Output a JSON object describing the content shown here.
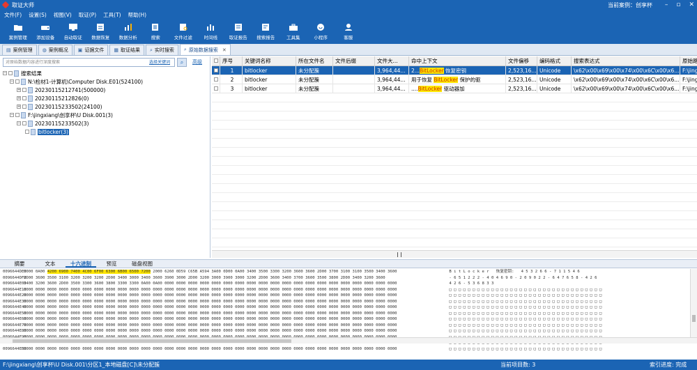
{
  "window": {
    "title": "取证大师",
    "current_case": "当前案例：创享杯",
    "min_btn": "–",
    "restore_btn": "▫",
    "close_btn": "✕"
  },
  "menu": [
    "文件(F)",
    "设置(S)",
    "视图(V)",
    "取证(P)",
    "工具(T)",
    "帮助(H)"
  ],
  "toolbar": [
    {
      "label": "案例管理",
      "icon": "folder-icon"
    },
    {
      "label": "添加设备",
      "icon": "add-device-icon"
    },
    {
      "label": "自动取证",
      "icon": "auto-forensics-icon"
    },
    {
      "label": "数据恢复",
      "icon": "data-recovery-icon"
    },
    {
      "label": "数据分析",
      "icon": "analysis-icon"
    },
    {
      "label": "搜索",
      "icon": "search-icon"
    },
    {
      "label": "文件过滤",
      "icon": "filter-icon"
    },
    {
      "label": "时间线",
      "icon": "timeline-icon"
    },
    {
      "label": "取证报告",
      "icon": "report-icon"
    },
    {
      "label": "搜索报告",
      "icon": "search-report-icon"
    },
    {
      "label": "工具集",
      "icon": "toolbox-icon"
    },
    {
      "label": "小程序",
      "icon": "miniapp-icon"
    },
    {
      "label": "客服",
      "icon": "support-icon"
    }
  ],
  "tabs": [
    {
      "label": "案例管理",
      "active": false
    },
    {
      "label": "案例概况",
      "active": false
    },
    {
      "label": "证据文件",
      "active": false
    },
    {
      "label": "取证结果",
      "active": false
    },
    {
      "label": "实时搜索",
      "active": false
    },
    {
      "label": "原始数据搜索",
      "active": true
    }
  ],
  "search": {
    "placeholder": "对原始数据内容进行深度搜索",
    "keyword_link": "选择关键词",
    "advanced": "高级"
  },
  "tree": [
    {
      "label": "搜索结果",
      "level": 0,
      "expander": "−",
      "selected": false
    },
    {
      "label": "N:\\检材1-计算机\\Computer Disk.E01(524100)",
      "level": 1,
      "expander": "−",
      "selected": false
    },
    {
      "label": "20230115212741(500000)",
      "level": 2,
      "expander": "+",
      "selected": false
    },
    {
      "label": "20230115212826(0)",
      "level": 2,
      "expander": "+",
      "selected": false
    },
    {
      "label": "20230115233502(24100)",
      "level": 2,
      "expander": "+",
      "selected": false
    },
    {
      "label": "F:\\jingxiang\\创享杯\\U Disk.001(3)",
      "level": 1,
      "expander": "−",
      "selected": false
    },
    {
      "label": "20230115233502(3)",
      "level": 2,
      "expander": "−",
      "selected": false
    },
    {
      "label": "bitlocker(3)",
      "level": 3,
      "expander": "",
      "selected": true
    }
  ],
  "grid": {
    "columns": [
      "序号",
      "关键词名称",
      "所在文件名",
      "文件后缀",
      "文件大...",
      "命中上下文",
      "文件偏移",
      "编码格式",
      "搜索表达式",
      "原始路"
    ],
    "rows": [
      {
        "seq": "1",
        "keyword": "bitlocker",
        "file": "未分配簇",
        "ext": "",
        "size": "3,964,44...",
        "ctx_pre": "2...",
        "ctx_hit": "BitLocker",
        "ctx_post": " 恢复密钥",
        "offset": "2,523,16...",
        "encoding": "Unicode",
        "expr": "\\x62\\x00\\x69\\x00\\x74\\x00\\x6C\\x00\\x6...",
        "path": "F:\\jing",
        "selected": true
      },
      {
        "seq": "2",
        "keyword": "bitlocker",
        "file": "未分配簇",
        "ext": "",
        "size": "3,964,44...",
        "ctx_pre": "用于恢复 ",
        "ctx_hit": "BitLocker",
        "ctx_post": " 保护的驱",
        "offset": "2,523,16...",
        "encoding": "Unicode",
        "expr": "\\x62\\x00\\x69\\x00\\x74\\x00\\x6C\\x00\\x6...",
        "path": "F:\\jing",
        "selected": false
      },
      {
        "seq": "3",
        "keyword": "bitlocker",
        "file": "未分配簇",
        "ext": "",
        "size": "3,964,44...",
        "ctx_pre": "....",
        "ctx_hit": "BitLocker",
        "ctx_post": " 驱动器加",
        "offset": "2,523,16...",
        "encoding": "Unicode",
        "expr": "\\x62\\x00\\x69\\x00\\x74\\x00\\x6C\\x00\\x6...",
        "path": "F:\\jing",
        "selected": false
      }
    ],
    "scroll_marker": "⦀"
  },
  "bottom_tabs": [
    {
      "label": "摘要",
      "active": false
    },
    {
      "label": "文本",
      "active": false
    },
    {
      "label": "十六进制",
      "active": true
    },
    {
      "label": "预览",
      "active": false
    },
    {
      "label": "磁盘视图",
      "active": false
    }
  ],
  "hex": [
    {
      "off": "0096644DE0",
      "pre": "0000 0A00 ",
      "hl": "4200 6900 7400 4C00 6F00 6300 6B00 6500 7200",
      "post": " 2000 6260 0D59 C65B A594 3A00 0D00 0A00 3400 3500 3300 3200 3600 3600 2D00 3700 3100 3100 3500 3400 3600",
      "ascii": " B i t L o c k e r   恢复密钥:   4 5 3 2 6 6 - 7 1 1 5 4 6"
    },
    {
      "off": "0096644DF0",
      "pre": "",
      "hl": "",
      "post": "2D00 3600 3500 3100 3200 3200 3200 2D00 3400 3000 3400 3600 3900 3000 2D00 3200 3000 3900 3000 3200 2D00 3600 3400 3700 3600 3500 3800 2D00 3400 3200 3600",
      "ascii": " - 6 5 1 2 2 2 - 4 0 4 6 9 0 - 2 0 9 0 2 2 - 6 4 7 6 5 8 - 4 2 6"
    },
    {
      "off": "0096644E00",
      "pre": "",
      "hl": "",
      "post": "3400 3200 3600 2D00 3500 3300 3600 3800 3300 3300 0A00 0A00 0000 0000 0000 0000 0000 0000 0000 0000 0000 0000 0000 0000 0000 0000 0000 0000 0000 0000 0000 0000",
      "ascii": " 4 2 6 - 5 3 6 8 3 3"
    },
    {
      "off": "0096644E10",
      "pre": "",
      "hl": "",
      "post": "0000 0000 0000 0000 0000 0000 0000 0000 0000 0000 0000 0000 0000 0000 0000 0000 0000 0000 0000 0000 0000 0000 0000 0000 0000 0000 0000 0000 0000 0000 0000 0000",
      "ascii": " □ □ □ □ □ □ □ □ □ □ □ □ □ □ □ □ □ □ □ □ □ □ □ □ □ □ □ □ □ □ □ □ □"
    },
    {
      "off": "0096644E20",
      "pre": "",
      "hl": "",
      "post": "0000 0000 0000 0000 0000 0000 0000 0000 0000 0000 0000 0000 0000 0000 0000 0000 0000 0000 0000 0000 0000 0000 0000 0000 0000 0000 0000 0000 0000 0000 0000 0000",
      "ascii": " □ □ □ □ □ □ □ □ □ □ □ □ □ □ □ □ □ □ □ □ □ □ □ □ □ □ □ □ □ □ □ □ □"
    },
    {
      "off": "0096644E30",
      "pre": "",
      "hl": "",
      "post": "0000 0000 0000 0000 0000 0000 0000 0000 0000 0000 0000 0000 0000 0000 0000 0000 0000 0000 0000 0000 0000 0000 0000 0000 0000 0000 0000 0000 0000 0000 0000 0000",
      "ascii": " □ □ □ □ □ □ □ □ □ □ □ □ □ □ □ □ □ □ □ □ □ □ □ □ □ □ □ □ □ □ □ □ □"
    },
    {
      "off": "0096644E40",
      "pre": "",
      "hl": "",
      "post": "0000 0000 0000 0000 0000 0000 0000 0000 0000 0000 0000 0000 0000 0000 0000 0000 0000 0000 0000 0000 0000 0000 0000 0000 0000 0000 0000 0000 0000 0000 0000 0000",
      "ascii": " □ □ □ □ □ □ □ □ □ □ □ □ □ □ □ □ □ □ □ □ □ □ □ □ □ □ □ □ □ □ □ □ □"
    },
    {
      "off": "0096644E50",
      "pre": "",
      "hl": "",
      "post": "0000 0000 0000 0000 0000 0000 0000 0000 0000 0000 0000 0000 0000 0000 0000 0000 0000 0000 0000 0000 0000 0000 0000 0000 0000 0000 0000 0000 0000 0000 0000 0000",
      "ascii": " □ □ □ □ □ □ □ □ □ □ □ □ □ □ □ □ □ □ □ □ □ □ □ □ □ □ □ □ □ □ □ □ □"
    },
    {
      "off": "0096644E60",
      "pre": "",
      "hl": "",
      "post": "0000 0000 0000 0000 0000 0000 0000 0000 0000 0000 0000 0000 0000 0000 0000 0000 0000 0000 0000 0000 0000 0000 0000 0000 0000 0000 0000 0000 0000 0000 0000 0000",
      "ascii": " □ □ □ □ □ □ □ □ □ □ □ □ □ □ □ □ □ □ □ □ □ □ □ □ □ □ □ □ □ □ □ □ □"
    },
    {
      "off": "0096644E70",
      "pre": "",
      "hl": "",
      "post": "0000 0000 0000 0000 0000 0000 0000 0000 0000 0000 0000 0000 0000 0000 0000 0000 0000 0000 0000 0000 0000 0000 0000 0000 0000 0000 0000 0000 0000 0000 0000 0000",
      "ascii": " □ □ □ □ □ □ □ □ □ □ □ □ □ □ □ □ □ □ □ □ □ □ □ □ □ □ □ □ □ □ □ □ □"
    },
    {
      "off": "0096644E80",
      "pre": "",
      "hl": "",
      "post": "0000 0000 0000 0000 0000 0000 0000 0000 0000 0000 0000 0000 0000 0000 0000 0000 0000 0000 0000 0000 0000 0000 0000 0000 0000 0000 0000 0000 0000 0000 0000 0000",
      "ascii": " □ □ □ □ □ □ □ □ □ □ □ □ □ □ □ □ □ □ □ □ □ □ □ □ □ □ □ □ □ □ □ □ □"
    },
    {
      "off": "0096644E90",
      "pre": "",
      "hl": "",
      "post": "0000 0000 0000 0000 0000 0000 0000 0000 0000 0000 0000 0000 0000 0000 0000 0000 0000 0000 0000 0000 0000 0000 0000 0000 0000 0000 0000 0000 0000 0000 0000 0000",
      "ascii": " □ □ □ □ □ □ □ □ □ □ □ □ □ □ □ □ □ □ □ □ □ □ □ □ □ □ □ □ □ □ □ □ □"
    },
    {
      "off": "0096644EA0",
      "pre": "",
      "hl": "",
      "post": "0000 0000 0000 0000 0000 0000 0000 0000 0000 0000 0000 0000 0000 0000 0000 0000 0000 0000 0000 0000 0000 0000 0000 0000 0000 0000 0000 0000 0000 0000 0000 0000",
      "ascii": " □ □ □ □ □ □ □ □ □ □ □ □ □ □ □ □ □ □ □ □ □ □ □ □ □ □ □ □ □ □ □ □ □"
    },
    {
      "off": "0096644EB0",
      "pre": "",
      "hl": "",
      "post": "0000 0000 0000 0000 0000 0000 0000 0000 0000 0000 0000 0000 0000 0000 0000 0000 0000 0000 0000 0000 0000 0000 0000 0000 0000 0000 0000 0000 0000 0000 0000 0000",
      "ascii": " □ □ □ □ □ □ □ □ □ □ □ □ □ □ □ □ □ □ □ □ □ □ □ □ □ □ □ □ □ □ □ □ □"
    }
  ],
  "status": {
    "path": "F:\\jingxiang\\创享杯\\U Disk.001\\分区1_本地磁盘[C]\\未分配簇",
    "count": "当前项目数: 3",
    "progress": "索引进度: 完成"
  }
}
